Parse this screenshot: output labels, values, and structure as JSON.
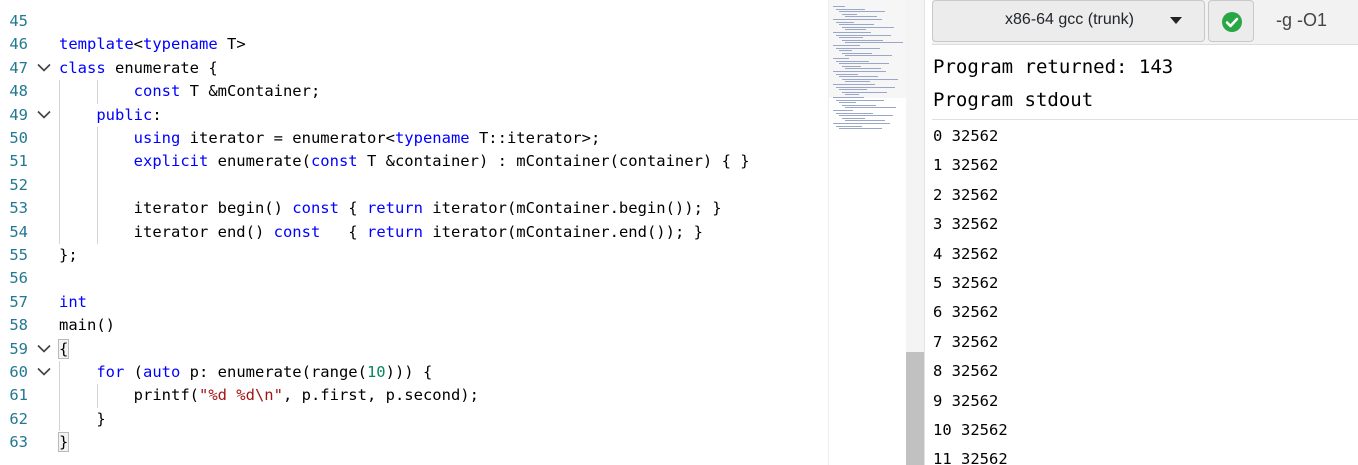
{
  "editor": {
    "lines": [
      {
        "n": "45",
        "code": ""
      },
      {
        "n": "46",
        "code": "<span class=\"kw\">template</span>&lt;<span class=\"kw\">typename</span> T&gt;"
      },
      {
        "n": "47",
        "code": "<span class=\"kw\">class</span> enumerate {",
        "fold": true
      },
      {
        "n": "48",
        "code": "        <span class=\"kw\">const</span> T &amp;mContainer;"
      },
      {
        "n": "49",
        "code": "    <span class=\"kw\">public</span>:",
        "fold": true
      },
      {
        "n": "50",
        "code": "        <span class=\"kw\">using</span> iterator = enumerator&lt;<span class=\"kw\">typename</span> T::iterator&gt;;"
      },
      {
        "n": "51",
        "code": "        <span class=\"kw\">explicit</span> enumerate(<span class=\"kw\">const</span> T &amp;container) : mContainer(container) { }"
      },
      {
        "n": "52",
        "code": ""
      },
      {
        "n": "53",
        "code": "        iterator begin() <span class=\"kw\">const</span> { <span class=\"kw\">return</span> iterator(mContainer.begin()); }"
      },
      {
        "n": "54",
        "code": "        iterator end() <span class=\"kw\">const</span>   { <span class=\"kw\">return</span> iterator(mContainer.end()); }"
      },
      {
        "n": "55",
        "code": "};"
      },
      {
        "n": "56",
        "code": ""
      },
      {
        "n": "57",
        "code": "<span class=\"kw\">int</span>"
      },
      {
        "n": "58",
        "code": "main()"
      },
      {
        "n": "59",
        "code": "<span class=\"bracket-hl\">{</span>",
        "fold": true
      },
      {
        "n": "60",
        "code": "    <span class=\"kw\">for</span> (<span class=\"kw\">auto</span> p: enumerate(range(<span class=\"num\">10</span>))) {",
        "fold": true
      },
      {
        "n": "61",
        "code": "        printf(<span class=\"str\">\"%d %d\\n\"</span>, p.first, p.second);"
      },
      {
        "n": "62",
        "code": "    }"
      },
      {
        "n": "63",
        "code": "<span class=\"bracket-hl\">}</span>"
      }
    ]
  },
  "compiler": {
    "name": "x86-64 gcc (trunk)",
    "options": "-g -O1",
    "status_color": "#28a745"
  },
  "output": {
    "returned": "Program returned: 143",
    "stdout_label": "Program stdout",
    "lines": [
      "0 32562",
      "1 32562",
      "2 32562",
      "3 32562",
      "4 32562",
      "5 32562",
      "6 32562",
      "7 32562",
      "8 32562",
      "9 32562",
      "10 32562",
      "11 32562"
    ]
  }
}
